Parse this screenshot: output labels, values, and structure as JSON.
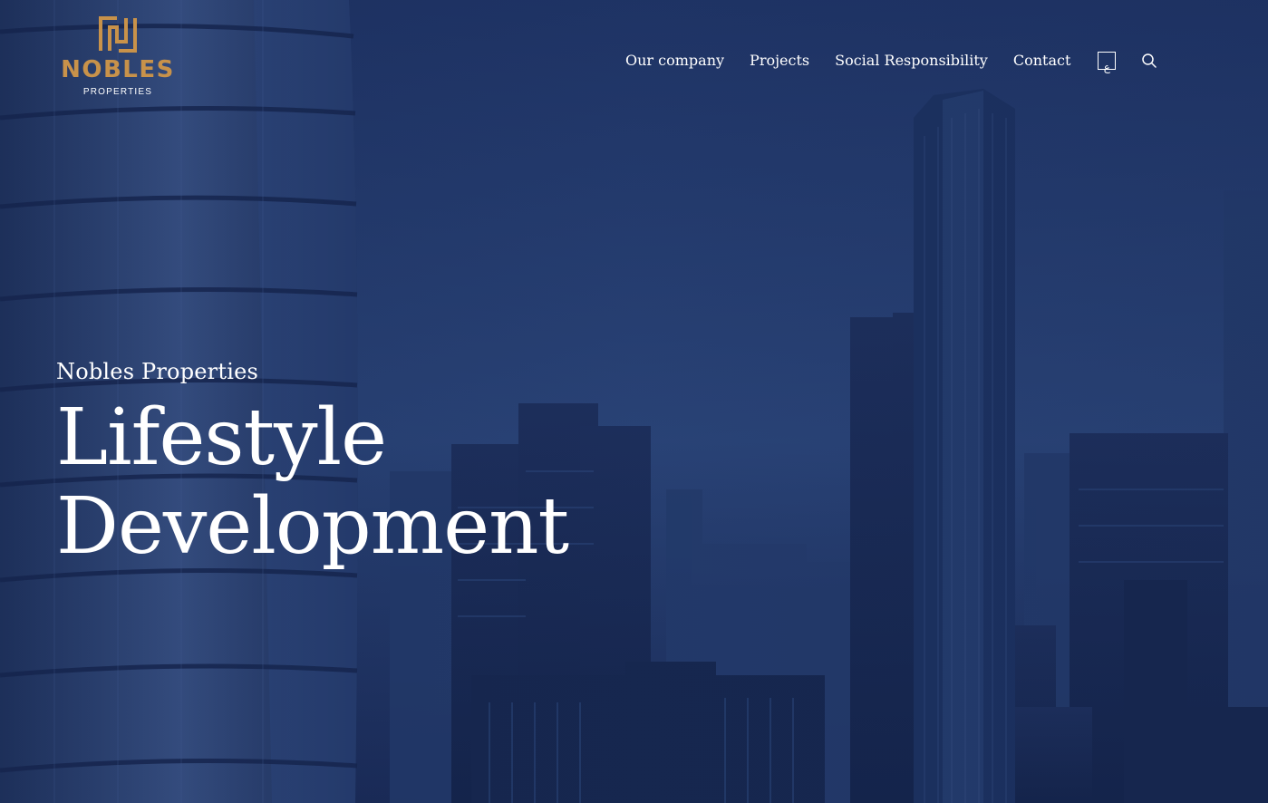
{
  "brand": {
    "name": "NOBLES",
    "sub": "PROPERTIES",
    "accent_color": "#c8924a"
  },
  "nav": {
    "items": [
      {
        "label": "Our company"
      },
      {
        "label": "Projects"
      },
      {
        "label": "Social Responsibility"
      },
      {
        "label": "Contact"
      }
    ],
    "language_label": "ع",
    "search_icon": "search-icon"
  },
  "hero": {
    "eyebrow": "Nobles Properties",
    "headline_line1": "Lifestyle",
    "headline_line2": "Development",
    "background": "city-skyline-blue-duotone"
  }
}
